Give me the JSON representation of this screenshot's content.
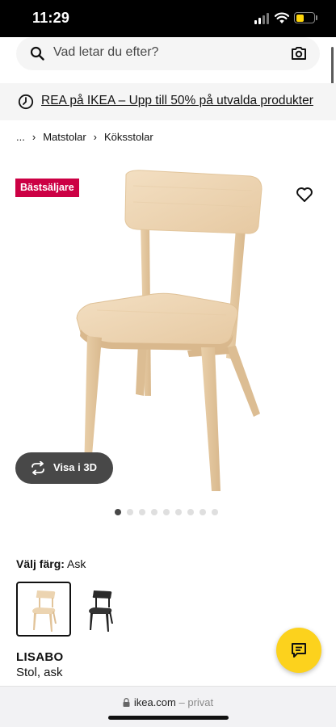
{
  "status_bar": {
    "time": "11:29",
    "battery_level": 0.45,
    "battery_color": "#ffd60a"
  },
  "search": {
    "placeholder": "Vad letar du efter?",
    "search_icon": "search-icon",
    "camera_icon": "camera-icon"
  },
  "promo": {
    "icon": "clock-icon",
    "text": "REA på IKEA – Upp till 50% på utvalda produkter"
  },
  "breadcrumb": {
    "ellipsis": "...",
    "items": [
      "Matstolar",
      "Köksstolar"
    ]
  },
  "product": {
    "badge": "Bästsäljare",
    "badge_color": "#cc0044",
    "favorite_icon": "heart-icon",
    "view_3d_label": "Visa i 3D",
    "image_count": 9,
    "active_image": 1,
    "color_label": "Välj färg:",
    "color_value": "Ask",
    "swatches": [
      {
        "name": "ask",
        "selected": true
      },
      {
        "name": "svart",
        "selected": false
      }
    ],
    "name": "LISABO",
    "description": "Stol, ask"
  },
  "chat": {
    "icon": "chat-icon",
    "color": "#fcd21d"
  },
  "browser": {
    "domain": "ikea.com",
    "separator": "–",
    "mode": "privat"
  }
}
